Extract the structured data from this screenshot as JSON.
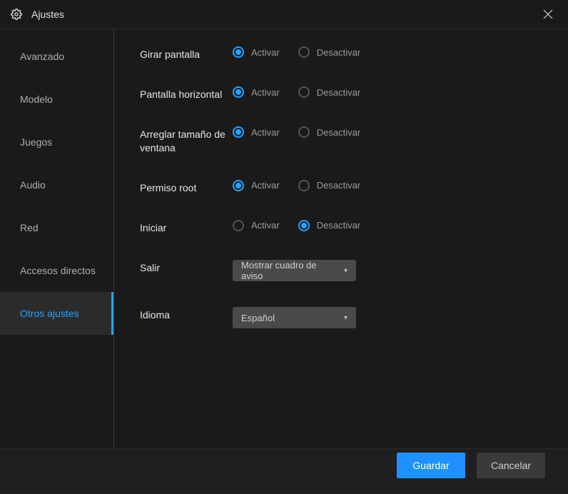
{
  "window": {
    "title": "Ajustes"
  },
  "sidebar": {
    "items": [
      {
        "label": "Avanzado"
      },
      {
        "label": "Modelo"
      },
      {
        "label": "Juegos"
      },
      {
        "label": "Audio"
      },
      {
        "label": "Red"
      },
      {
        "label": "Accesos directos"
      },
      {
        "label": "Otros ajustes"
      }
    ],
    "active_index": 6
  },
  "options": {
    "activate_label": "Activar",
    "deactivate_label": "Desactivar",
    "rotate_screen": {
      "label": "Girar pantalla",
      "value": "activate"
    },
    "horizontal_screen": {
      "label": "Pantalla horizontal",
      "value": "activate"
    },
    "fix_window_size": {
      "label": "Arreglar tamaño de ventana",
      "value": "activate"
    },
    "root_permission": {
      "label": "Permiso root",
      "value": "activate"
    },
    "start": {
      "label": "Iniciar",
      "value": "deactivate"
    },
    "exit": {
      "label": "Salir",
      "selected": "Mostrar cuadro de aviso"
    },
    "language": {
      "label": "Idioma",
      "selected": "Español"
    }
  },
  "footer": {
    "save": "Guardar",
    "cancel": "Cancelar"
  }
}
